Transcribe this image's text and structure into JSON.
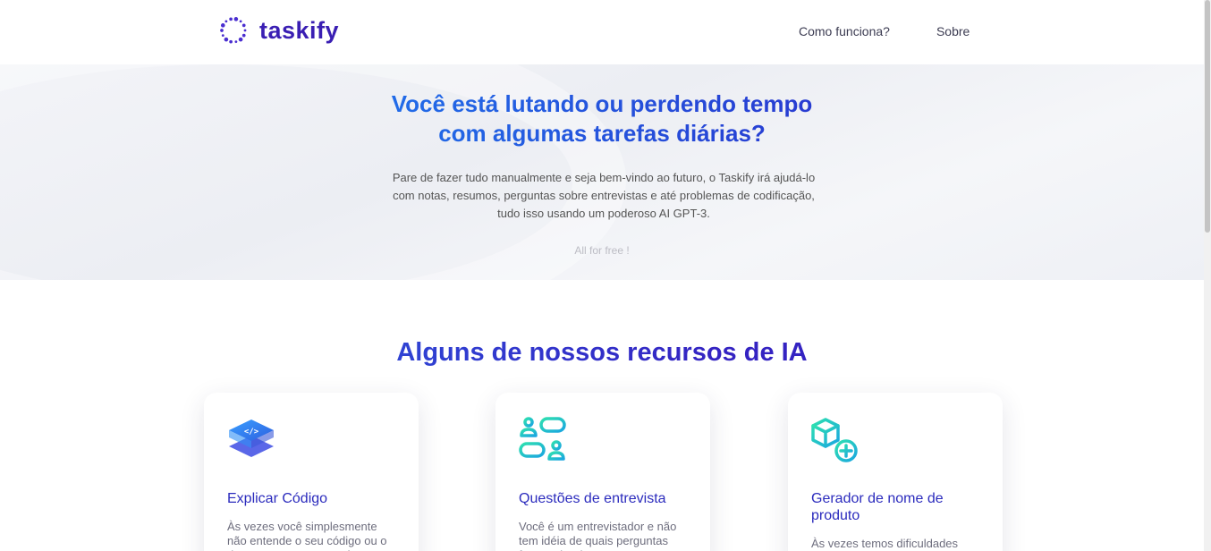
{
  "brand": {
    "name": "taskify"
  },
  "nav": {
    "items": [
      "Como funciona?",
      "Sobre"
    ]
  },
  "hero": {
    "title_line1": "Você está lutando ou perdendo tempo",
    "title_line2": "com algumas tarefas diárias?",
    "lead": "Pare de fazer tudo manualmente e seja bem-vindo ao futuro, o Taskify irá ajudá-lo com notas, resumos, perguntas sobre entrevistas e até problemas de codificação, tudo isso usando um poderoso AI GPT-3.",
    "free_note": "All for free !"
  },
  "features": {
    "title": "Alguns de nossos recursos de IA",
    "cards": [
      {
        "title": "Explicar Código",
        "text": "Às vezes você simplesmente não entende o seu código ou o de outras pessoas, e nós",
        "icon": "code-layers-icon"
      },
      {
        "title": "Questões de entrevista",
        "text": "Você é um entrevistador e não tem idéia de quais perguntas fazer sobre isso? Gere",
        "icon": "interview-icon"
      },
      {
        "title": "Gerador de nome de produto",
        "text": "Às vezes temos dificuldades para colocar um nome em um",
        "icon": "box-add-icon"
      }
    ]
  },
  "colors": {
    "brand": "#3a1fb3",
    "accent_blue": "#1f7df0",
    "accent_teal": "#22c7c0",
    "card_title": "#2b2bbd"
  }
}
